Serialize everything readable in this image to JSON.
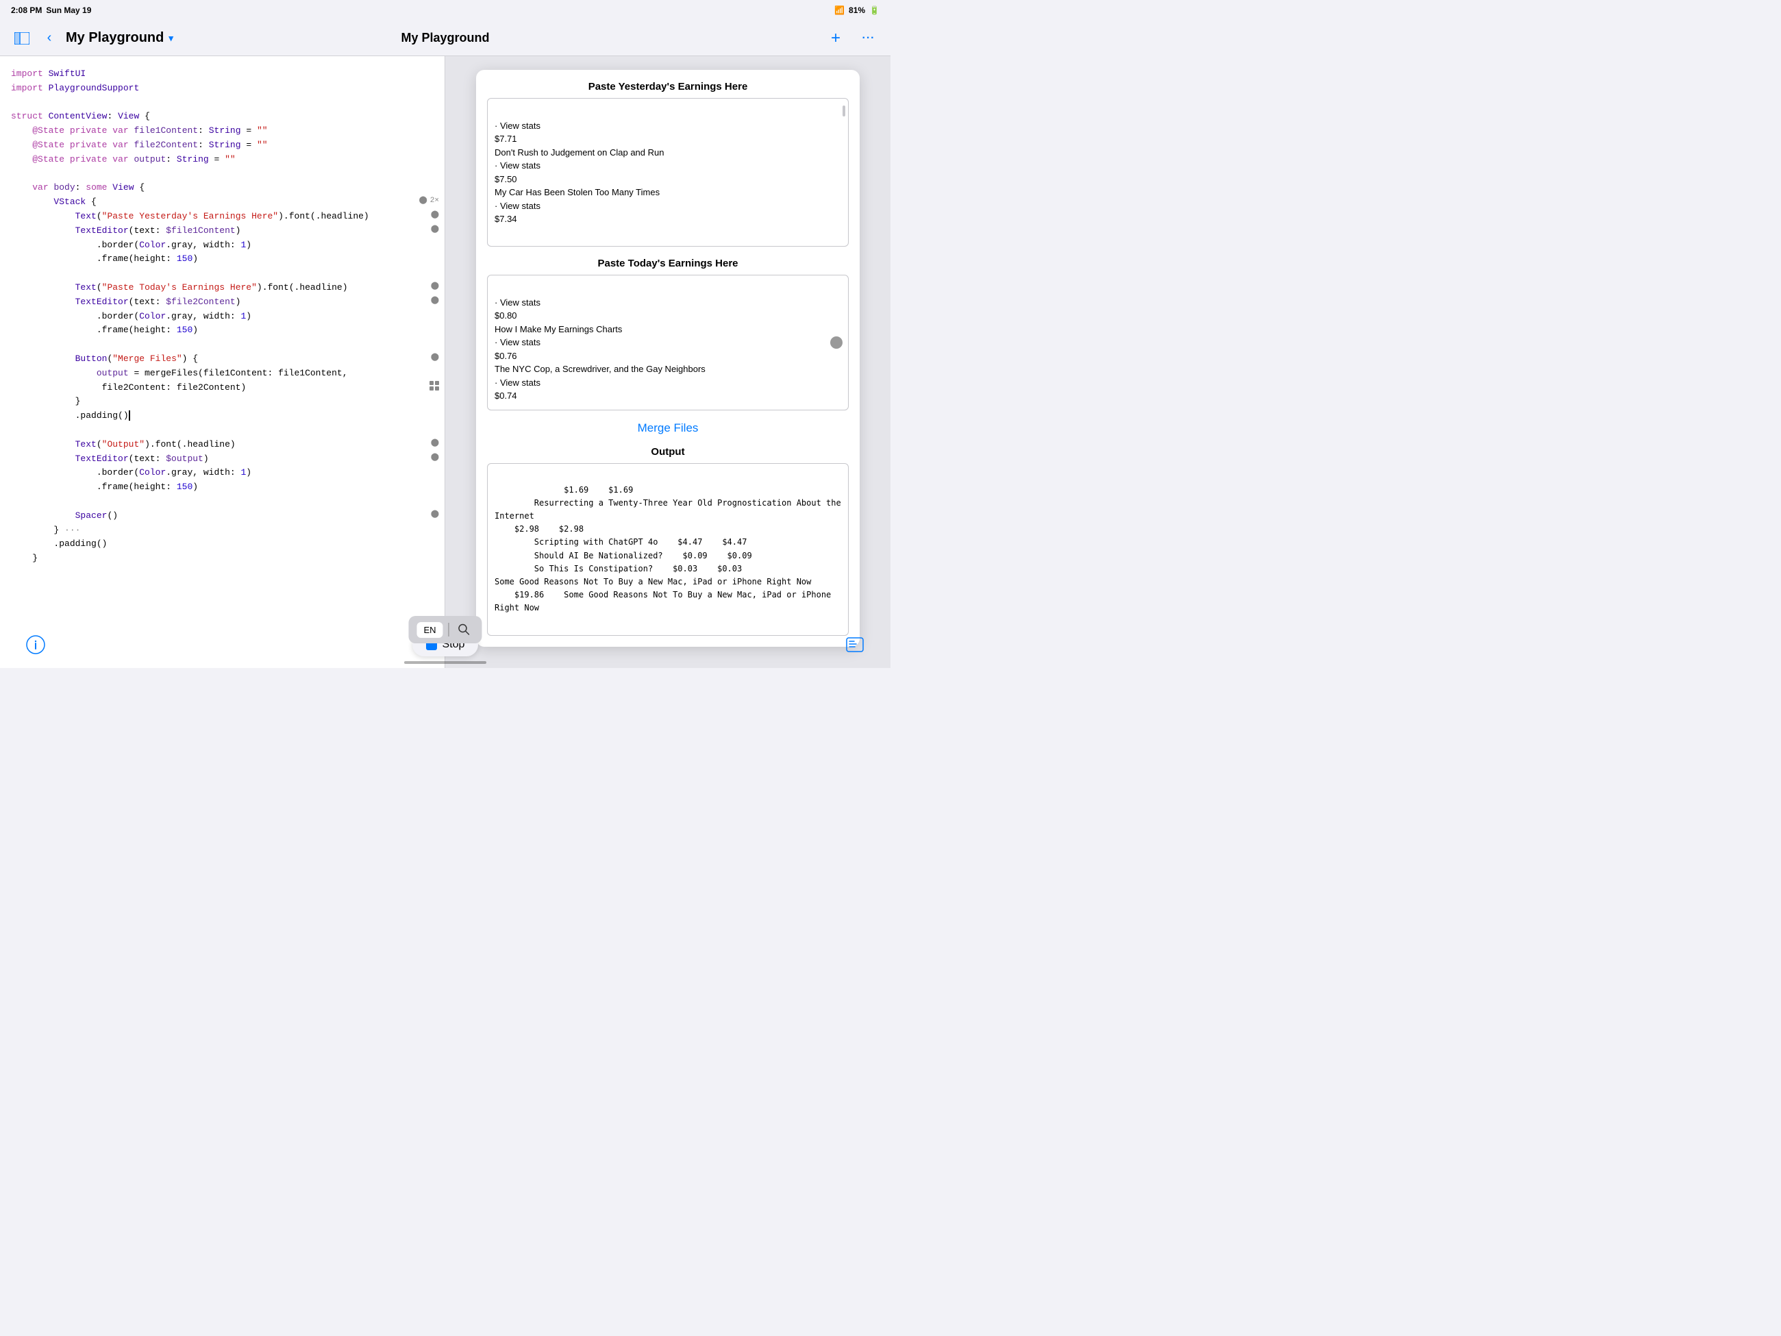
{
  "statusBar": {
    "time": "2:08 PM",
    "date": "Sun May 19",
    "wifi": "▲",
    "battery": "81%",
    "batteryIcon": "🔋"
  },
  "navBar": {
    "sidebarToggleIcon": "sidebar",
    "backIcon": "‹",
    "title": "My Playground",
    "chevron": "∨",
    "centerTitle": "My Playground",
    "addIcon": "+",
    "moreIcon": "···"
  },
  "codeEditor": {
    "lines": [
      {
        "text": "import SwiftUI",
        "indent": 0,
        "type": "import"
      },
      {
        "text": "import PlaygroundSupport",
        "indent": 0,
        "type": "import"
      },
      {
        "text": "",
        "indent": 0,
        "type": "blank"
      },
      {
        "text": "struct ContentView: View {",
        "indent": 0,
        "type": "struct"
      },
      {
        "text": "    @State private var file1Content: String = \"\"",
        "indent": 1,
        "type": "state"
      },
      {
        "text": "    @State private var file2Content: String = \"\"",
        "indent": 1,
        "type": "state"
      },
      {
        "text": "    @State private var output: String = \"\"",
        "indent": 1,
        "type": "state"
      },
      {
        "text": "",
        "indent": 0,
        "type": "blank"
      },
      {
        "text": "    var body: some View {",
        "indent": 1,
        "type": "var"
      },
      {
        "text": "        VStack {",
        "indent": 2,
        "type": "vstack",
        "badge": "run"
      },
      {
        "text": "            Text(\"Paste Yesterday's Earnings Here\").font(.headline)",
        "indent": 3,
        "type": "text",
        "badge": "run"
      },
      {
        "text": "            TextEditor(text: $file1Content)",
        "indent": 3,
        "type": "text",
        "badge": "run"
      },
      {
        "text": "                .border(Color.gray, width: 1)",
        "indent": 4,
        "type": "modifier"
      },
      {
        "text": "                .frame(height: 150)",
        "indent": 4,
        "type": "modifier"
      },
      {
        "text": "",
        "indent": 0,
        "type": "blank"
      },
      {
        "text": "            Text(\"Paste Today's Earnings Here\").font(.headline)",
        "indent": 3,
        "type": "text",
        "badge": "run"
      },
      {
        "text": "            TextEditor(text: $file2Content)",
        "indent": 3,
        "type": "text",
        "badge": "run"
      },
      {
        "text": "                .border(Color.gray, width: 1)",
        "indent": 4,
        "type": "modifier"
      },
      {
        "text": "                .frame(height: 150)",
        "indent": 4,
        "type": "modifier"
      },
      {
        "text": "",
        "indent": 0,
        "type": "blank"
      },
      {
        "text": "            Button(\"Merge Files\") {",
        "indent": 3,
        "type": "button",
        "badge": "run"
      },
      {
        "text": "                output = mergeFiles(file1Content: file1Content,",
        "indent": 4,
        "type": "plain"
      },
      {
        "text": "                 file2Content: file2Content)",
        "indent": 4,
        "type": "plain",
        "badge": "grid"
      },
      {
        "text": "            }",
        "indent": 3,
        "type": "brace"
      },
      {
        "text": "            .padding()",
        "indent": 3,
        "type": "modifier",
        "cursor": true
      },
      {
        "text": "",
        "indent": 0,
        "type": "blank"
      },
      {
        "text": "            Text(\"Output\").font(.headline)",
        "indent": 3,
        "type": "text",
        "badge": "run"
      },
      {
        "text": "            TextEditor(text: $output)",
        "indent": 3,
        "type": "text",
        "badge": "run"
      },
      {
        "text": "                .border(Color.gray, width: 1)",
        "indent": 4,
        "type": "modifier"
      },
      {
        "text": "                .frame(height: 150)",
        "indent": 4,
        "type": "modifier"
      },
      {
        "text": "",
        "indent": 0,
        "type": "blank"
      },
      {
        "text": "            Spacer()",
        "indent": 3,
        "type": "spacer",
        "badge": "run"
      },
      {
        "text": "        } ···",
        "indent": 2,
        "type": "brace-dots"
      },
      {
        "text": "        .padding()",
        "indent": 2,
        "type": "modifier"
      },
      {
        "text": "    }",
        "indent": 1,
        "type": "brace"
      }
    ]
  },
  "preview": {
    "section1Title": "Paste Yesterday's Earnings Here",
    "section1Content": "· View stats\n$7.71\nDon't Rush to Judgement on Clap and Run\n· View stats\n$7.50\nMy Car Has Been Stolen Too Many Times\n· View stats\n$7.34",
    "section2Title": "Paste Today's Earnings Here",
    "section2Content": "· View stats\n$0.80\nHow I Make My Earnings Charts\n· View stats\n$0.76\nThe NYC Cop, a Screwdriver, and the Gay Neighbors\n· View stats\n$0.74",
    "mergeButtonLabel": "Merge Files",
    "outputTitle": "Output",
    "outputContent": "    $1.69    $1.69\n        Resurrecting a Twenty-Three Year Old Prognostication About the Internet\n    $2.98    $2.98\n        Scripting with ChatGPT 4o    $4.47    $4.47\n        Should AI Be Nationalized?    $0.09    $0.09\n        So This Is Constipation?    $0.03    $0.03\nSome Good Reasons Not To Buy a New Mac, iPad or iPhone Right Now\n    $19.86    Some Good Reasons Not To Buy a New Mac, iPad or iPhone Right Now"
  },
  "bottomBar": {
    "leftIcon": "ℹ",
    "stopLabel": "Stop",
    "rightIcon": "≡"
  },
  "keyboardToolbar": {
    "langLabel": "EN",
    "searchIcon": "⌕"
  }
}
